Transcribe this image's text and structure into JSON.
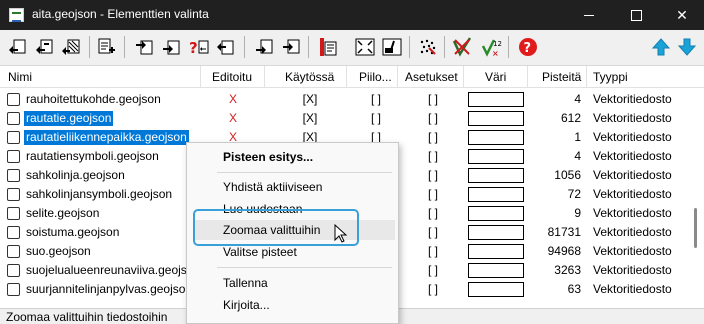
{
  "window": {
    "title": "aita.geojson - Elementtien valinta",
    "minimize": "—",
    "maximize": "",
    "close": "✕"
  },
  "toolbar": {
    "icons": [
      "select-all-icon",
      "select-toggle-icon",
      "select-pattern-icon",
      "add-file-icon",
      "move-up-icon",
      "move-down-icon",
      "ungroup-icon",
      "open-file-icon",
      "reload-icon",
      "select-layer-icon",
      "zoom-extent-icon",
      "zoom-selection-icon",
      "dots-grid-icon",
      "edit-check-icon",
      "numbered-tick-icon",
      "help-icon",
      "arrow-up-icon",
      "arrow-down-icon"
    ]
  },
  "table": {
    "headers": {
      "name": "Nimi",
      "edited": "Editoitu",
      "in_use": "Käytössä",
      "hidden": "Piilo...",
      "settings": "Asetukset",
      "color": "Väri",
      "points": "Pisteitä",
      "type": "Tyyppi"
    },
    "rows": [
      {
        "name": "rauhoitettukohde.geojson",
        "edited": "X",
        "in_use": "[X]",
        "hidden": "[ ]",
        "settings": "[ ]",
        "points": "4",
        "type": "Vektoritiedosto",
        "selected": false
      },
      {
        "name": "rautatie.geojson",
        "edited": "X",
        "in_use": "[X]",
        "hidden": "[ ]",
        "settings": "[ ]",
        "points": "612",
        "type": "Vektoritiedosto",
        "selected": true
      },
      {
        "name": "rautatieliikennepaikka.geojson",
        "edited": "X",
        "in_use": "[X]",
        "hidden": "[ ]",
        "settings": "[ ]",
        "points": "1",
        "type": "Vektoritiedosto",
        "selected": true
      },
      {
        "name": "rautatiensymboli.geojson",
        "edited": "",
        "in_use": "",
        "hidden": "",
        "settings": "[ ]",
        "points": "4",
        "type": "Vektoritiedosto",
        "selected": false
      },
      {
        "name": "sahkolinja.geojson",
        "edited": "",
        "in_use": "",
        "hidden": "",
        "settings": "[ ]",
        "points": "1056",
        "type": "Vektoritiedosto",
        "selected": false
      },
      {
        "name": "sahkolinjansymboli.geojson",
        "edited": "",
        "in_use": "",
        "hidden": "",
        "settings": "[ ]",
        "points": "72",
        "type": "Vektoritiedosto",
        "selected": false
      },
      {
        "name": "selite.geojson",
        "edited": "",
        "in_use": "",
        "hidden": "",
        "settings": "[ ]",
        "points": "9",
        "type": "Vektoritiedosto",
        "selected": false
      },
      {
        "name": "soistuma.geojson",
        "edited": "",
        "in_use": "",
        "hidden": "",
        "settings": "[ ]",
        "points": "81731",
        "type": "Vektoritiedosto",
        "selected": false
      },
      {
        "name": "suo.geojson",
        "edited": "",
        "in_use": "",
        "hidden": "",
        "settings": "[ ]",
        "points": "94968",
        "type": "Vektoritiedosto",
        "selected": false
      },
      {
        "name": "suojelualueenreunaviiva.geojson",
        "edited": "",
        "in_use": "",
        "hidden": "",
        "settings": "[ ]",
        "points": "3263",
        "type": "Vektoritiedosto",
        "selected": false
      },
      {
        "name": "suurjannitelinjanpylvas.geojson",
        "edited": "",
        "in_use": "",
        "hidden": "",
        "settings": "[ ]",
        "points": "63",
        "type": "Vektoritiedosto",
        "selected": false
      }
    ]
  },
  "context_menu": {
    "items": [
      {
        "label": "Pisteen esitys...",
        "bold": true
      },
      {
        "label": "Yhdistä aktiiviseen"
      },
      {
        "label": "Lue uudestaan"
      },
      {
        "label": "Zoomaa valittuihin",
        "hover": true
      },
      {
        "label": "Valitse pisteet"
      },
      {
        "label": "Tallenna"
      },
      {
        "label": "Kirjoita..."
      }
    ]
  },
  "statusbar": {
    "text": "Zoomaa valittuihin tiedostoihin"
  },
  "colors": {
    "titlebar": "#202020",
    "selection": "#0078d7",
    "edited_mark": "#d02020",
    "highlight_box": "#3aa0d8",
    "help_icon": "#e11b1b",
    "arrow_icons": "#1aa3d9"
  }
}
